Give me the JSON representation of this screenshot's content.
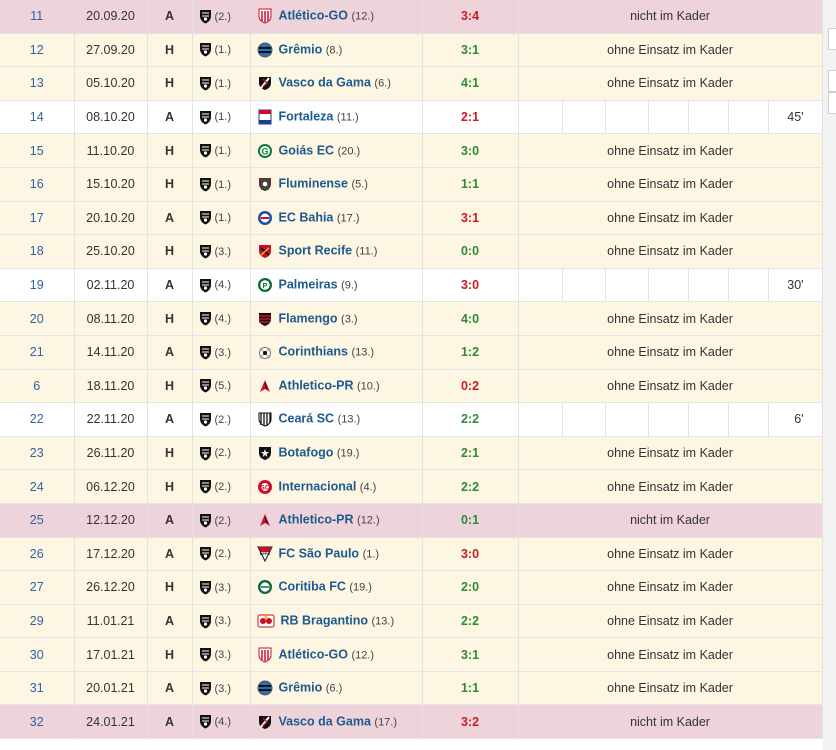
{
  "matches": [
    {
      "spieltag": "11",
      "datum": "20.09.20",
      "venue": "A",
      "own_rank": "(2.)",
      "opponent": "Atlético-GO",
      "opp_rank": "(12.)",
      "result": "3:4",
      "result_type": "loss",
      "status": "nicht im Kader",
      "row_style": "red",
      "minute": "",
      "opp_crest": "atletico-go-crest"
    },
    {
      "spieltag": "12",
      "datum": "27.09.20",
      "venue": "H",
      "own_rank": "(1.)",
      "opponent": "Grêmio",
      "opp_rank": "(8.)",
      "result": "3:1",
      "result_type": "win",
      "status": "ohne Einsatz im Kader",
      "row_style": "yellow",
      "minute": "",
      "opp_crest": "gremio-crest"
    },
    {
      "spieltag": "13",
      "datum": "05.10.20",
      "venue": "H",
      "own_rank": "(1.)",
      "opponent": "Vasco da Gama",
      "opp_rank": "(6.)",
      "result": "4:1",
      "result_type": "win",
      "status": "ohne Einsatz im Kader",
      "row_style": "yellow",
      "minute": "",
      "opp_crest": "vasco-crest"
    },
    {
      "spieltag": "14",
      "datum": "08.10.20",
      "venue": "A",
      "own_rank": "(1.)",
      "opponent": "Fortaleza",
      "opp_rank": "(11.)",
      "result": "2:1",
      "result_type": "loss",
      "status": "",
      "row_style": "white",
      "minute": "45'",
      "opp_crest": "fortaleza-crest"
    },
    {
      "spieltag": "15",
      "datum": "11.10.20",
      "venue": "H",
      "own_rank": "(1.)",
      "opponent": "Goiás EC",
      "opp_rank": "(20.)",
      "result": "3:0",
      "result_type": "win",
      "status": "ohne Einsatz im Kader",
      "row_style": "yellow",
      "minute": "",
      "opp_crest": "goias-crest"
    },
    {
      "spieltag": "16",
      "datum": "15.10.20",
      "venue": "H",
      "own_rank": "(1.)",
      "opponent": "Fluminense",
      "opp_rank": "(5.)",
      "result": "1:1",
      "result_type": "draw",
      "status": "ohne Einsatz im Kader",
      "row_style": "yellow",
      "minute": "",
      "opp_crest": "fluminense-crest"
    },
    {
      "spieltag": "17",
      "datum": "20.10.20",
      "venue": "A",
      "own_rank": "(1.)",
      "opponent": "EC Bahia",
      "opp_rank": "(17.)",
      "result": "3:1",
      "result_type": "loss",
      "status": "ohne Einsatz im Kader",
      "row_style": "yellow",
      "minute": "",
      "opp_crest": "bahia-crest"
    },
    {
      "spieltag": "18",
      "datum": "25.10.20",
      "venue": "H",
      "own_rank": "(3.)",
      "opponent": "Sport Recife",
      "opp_rank": "(11.)",
      "result": "0:0",
      "result_type": "draw",
      "status": "ohne Einsatz im Kader",
      "row_style": "yellow",
      "minute": "",
      "opp_crest": "sport-recife-crest"
    },
    {
      "spieltag": "19",
      "datum": "02.11.20",
      "venue": "A",
      "own_rank": "(4.)",
      "opponent": "Palmeiras",
      "opp_rank": "(9.)",
      "result": "3:0",
      "result_type": "loss",
      "status": "",
      "row_style": "white",
      "minute": "30'",
      "opp_crest": "palmeiras-crest"
    },
    {
      "spieltag": "20",
      "datum": "08.11.20",
      "venue": "H",
      "own_rank": "(4.)",
      "opponent": "Flamengo",
      "opp_rank": "(3.)",
      "result": "4:0",
      "result_type": "win",
      "status": "ohne Einsatz im Kader",
      "row_style": "yellow",
      "minute": "",
      "opp_crest": "flamengo-crest"
    },
    {
      "spieltag": "21",
      "datum": "14.11.20",
      "venue": "A",
      "own_rank": "(3.)",
      "opponent": "Corinthians",
      "opp_rank": "(13.)",
      "result": "1:2",
      "result_type": "win",
      "status": "ohne Einsatz im Kader",
      "row_style": "yellow",
      "minute": "",
      "opp_crest": "corinthians-crest"
    },
    {
      "spieltag": "6",
      "datum": "18.11.20",
      "venue": "H",
      "own_rank": "(5.)",
      "opponent": "Athletico-PR",
      "opp_rank": "(10.)",
      "result": "0:2",
      "result_type": "loss",
      "status": "ohne Einsatz im Kader",
      "row_style": "yellow",
      "minute": "",
      "opp_crest": "athletico-pr-crest"
    },
    {
      "spieltag": "22",
      "datum": "22.11.20",
      "venue": "A",
      "own_rank": "(2.)",
      "opponent": "Ceará SC",
      "opp_rank": "(13.)",
      "result": "2:2",
      "result_type": "draw",
      "status": "",
      "row_style": "white",
      "minute": "6'",
      "opp_crest": "ceara-crest"
    },
    {
      "spieltag": "23",
      "datum": "26.11.20",
      "venue": "H",
      "own_rank": "(2.)",
      "opponent": "Botafogo",
      "opp_rank": "(19.)",
      "result": "2:1",
      "result_type": "win",
      "status": "ohne Einsatz im Kader",
      "row_style": "yellow",
      "minute": "",
      "opp_crest": "botafogo-crest"
    },
    {
      "spieltag": "24",
      "datum": "06.12.20",
      "venue": "H",
      "own_rank": "(2.)",
      "opponent": "Internacional",
      "opp_rank": "(4.)",
      "result": "2:2",
      "result_type": "draw",
      "status": "ohne Einsatz im Kader",
      "row_style": "yellow",
      "minute": "",
      "opp_crest": "internacional-crest"
    },
    {
      "spieltag": "25",
      "datum": "12.12.20",
      "venue": "A",
      "own_rank": "(2.)",
      "opponent": "Athletico-PR",
      "opp_rank": "(12.)",
      "result": "0:1",
      "result_type": "win",
      "status": "nicht im Kader",
      "row_style": "red",
      "minute": "",
      "opp_crest": "athletico-pr-crest"
    },
    {
      "spieltag": "26",
      "datum": "17.12.20",
      "venue": "A",
      "own_rank": "(2.)",
      "opponent": "FC São Paulo",
      "opp_rank": "(1.)",
      "result": "3:0",
      "result_type": "loss",
      "status": "ohne Einsatz im Kader",
      "row_style": "yellow",
      "minute": "",
      "opp_crest": "sao-paulo-crest"
    },
    {
      "spieltag": "27",
      "datum": "26.12.20",
      "venue": "H",
      "own_rank": "(3.)",
      "opponent": "Coritiba FC",
      "opp_rank": "(19.)",
      "result": "2:0",
      "result_type": "win",
      "status": "ohne Einsatz im Kader",
      "row_style": "yellow",
      "minute": "",
      "opp_crest": "coritiba-crest"
    },
    {
      "spieltag": "29",
      "datum": "11.01.21",
      "venue": "A",
      "own_rank": "(3.)",
      "opponent": "RB Bragantino",
      "opp_rank": "(13.)",
      "result": "2:2",
      "result_type": "draw",
      "status": "ohne Einsatz im Kader",
      "row_style": "yellow",
      "minute": "",
      "opp_crest": "bragantino-crest"
    },
    {
      "spieltag": "30",
      "datum": "17.01.21",
      "venue": "H",
      "own_rank": "(3.)",
      "opponent": "Atlético-GO",
      "opp_rank": "(12.)",
      "result": "3:1",
      "result_type": "win",
      "status": "ohne Einsatz im Kader",
      "row_style": "yellow",
      "minute": "",
      "opp_crest": "atletico-go-crest"
    },
    {
      "spieltag": "31",
      "datum": "20.01.21",
      "venue": "A",
      "own_rank": "(3.)",
      "opponent": "Grêmio",
      "opp_rank": "(6.)",
      "result": "1:1",
      "result_type": "draw",
      "status": "ohne Einsatz im Kader",
      "row_style": "yellow",
      "minute": "",
      "opp_crest": "gremio-crest"
    },
    {
      "spieltag": "32",
      "datum": "24.01.21",
      "venue": "A",
      "own_rank": "(4.)",
      "opponent": "Vasco da Gama",
      "opp_rank": "(17.)",
      "result": "3:2",
      "result_type": "loss",
      "status": "nicht im Kader",
      "row_style": "red",
      "minute": "",
      "opp_crest": "vasco-crest"
    }
  ],
  "own_club": {
    "crest": "atletico-mg-crest"
  },
  "colors": {
    "row_yellow": "#fcf6e2",
    "row_white": "#ffffff",
    "row_red": "#efd3da",
    "link_blue": "#1d5a8e",
    "win_green": "#2e8b3a",
    "loss_red": "#c81d25"
  }
}
